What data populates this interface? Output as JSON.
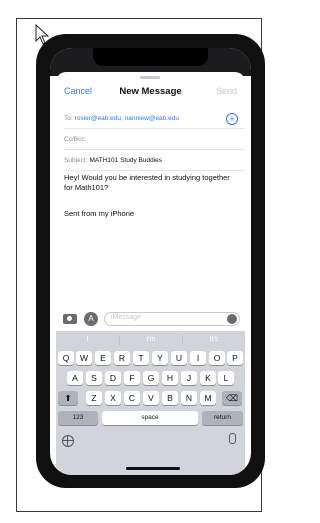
{
  "compose": {
    "cancel": "Cancel",
    "title": "New Message",
    "send": "Send",
    "to_label": "To:",
    "to_value": "rosier@eab.edu, nanniew@eab.edu",
    "ccbcc_label": "Cc/Bcc:",
    "subject_label": "Subject:",
    "subject_value": "MATH101 Study Buddies",
    "body": "Hey! Would you be interested in studying together for Math101?",
    "signature": "Sent from my iPhone"
  },
  "message_bar": {
    "placeholder": "iMessage",
    "icons": [
      "camera-icon",
      "app-store-icon",
      "audio-icon"
    ]
  },
  "keyboard": {
    "suggestions": [
      "I",
      "I'm",
      "It's"
    ],
    "row1": [
      "Q",
      "W",
      "E",
      "R",
      "T",
      "Y",
      "U",
      "I",
      "O",
      "P"
    ],
    "row2": [
      "A",
      "S",
      "D",
      "F",
      "G",
      "H",
      "J",
      "K",
      "L"
    ],
    "row3": [
      "Z",
      "X",
      "C",
      "V",
      "B",
      "N",
      "M"
    ],
    "shift": "⬆",
    "backspace": "⌫",
    "numbers": "123",
    "space": "space",
    "return": "return"
  }
}
